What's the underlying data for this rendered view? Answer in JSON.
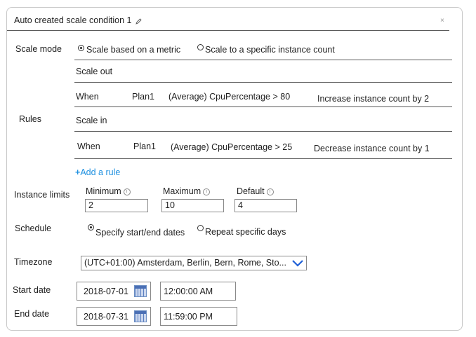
{
  "header": {
    "title": "Auto created scale condition 1",
    "close_glyph": "×"
  },
  "scale_mode": {
    "label": "Scale mode",
    "options": [
      {
        "label": "Scale based on a metric",
        "selected": true
      },
      {
        "label": "Scale to a specific instance count",
        "selected": false
      }
    ]
  },
  "rules": {
    "label": "Rules",
    "scale_out": {
      "title": "Scale out",
      "when": "When",
      "resource": "Plan1",
      "condition": "(Average) CpuPercentage > 80",
      "action": "Increase instance count by 2"
    },
    "scale_in": {
      "title": "Scale in",
      "when": "When",
      "resource": "Plan1",
      "condition": "(Average) CpuPercentage > 25",
      "action": "Decrease instance count by 1"
    },
    "add_rule": "Add a rule",
    "add_glyph": "+"
  },
  "instance_limits": {
    "label": "Instance limits",
    "minimum": {
      "label": "Minimum",
      "value": "2"
    },
    "maximum": {
      "label": "Maximum",
      "value": "10"
    },
    "default": {
      "label": "Default",
      "value": "4"
    }
  },
  "schedule": {
    "label": "Schedule",
    "options": [
      {
        "label": "Specify start/end dates",
        "selected": true
      },
      {
        "label": "Repeat specific days",
        "selected": false
      }
    ]
  },
  "timezone": {
    "label": "Timezone",
    "value": "(UTC+01:00) Amsterdam, Berlin, Bern, Rome, Sto..."
  },
  "start": {
    "label": "Start date",
    "date": "2018-07-01",
    "time": "12:00:00 AM"
  },
  "end": {
    "label": "End date",
    "date": "2018-07-31",
    "time": "11:59:00 PM"
  },
  "colors": {
    "link": "#1e90e0",
    "border": "#5a5a5a"
  }
}
